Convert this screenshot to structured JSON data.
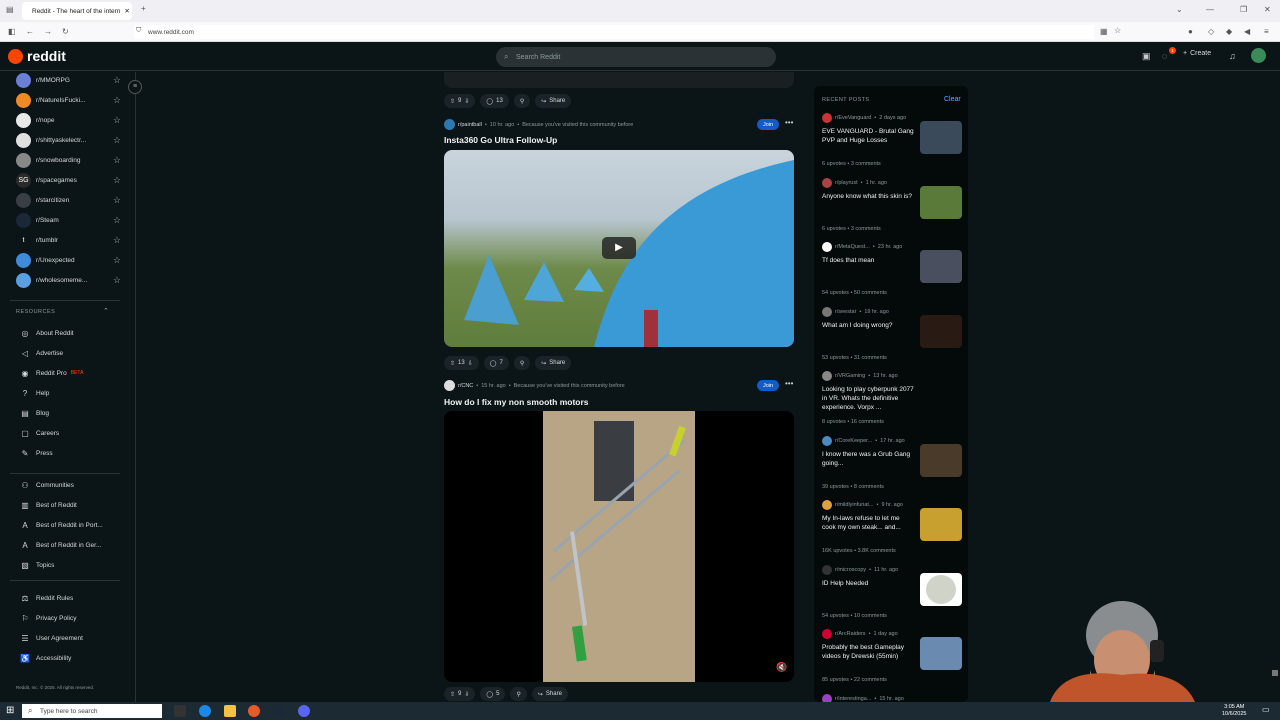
{
  "browser": {
    "tab_title": "Reddit - The heart of the intern",
    "url": "www.reddit.com"
  },
  "header": {
    "logo_text": "reddit",
    "search_placeholder": "Search Reddit",
    "create_label": "Create",
    "notif_badge": "1"
  },
  "sidebar": {
    "subs": [
      {
        "name": "r/MMORPG",
        "color": "#6b7fd7"
      },
      {
        "name": "r/NatureIsFucki...",
        "color": "#f08a24"
      },
      {
        "name": "r/nope",
        "color": "#e8e8e8"
      },
      {
        "name": "r/shittyaskelectr...",
        "color": "#e0e0e0"
      },
      {
        "name": "r/snowboarding",
        "color": "#888888"
      },
      {
        "name": "r/spacegames",
        "color": "#2a2a2a",
        "text": "SG"
      },
      {
        "name": "r/starcitizen",
        "color": "#3a3f45"
      },
      {
        "name": "r/Steam",
        "color": "#1b2838"
      },
      {
        "name": "r/tumblr",
        "color": "#0b1416",
        "text": "t"
      },
      {
        "name": "r/Unexpected",
        "color": "#3d8bd9"
      },
      {
        "name": "r/wholesomeme...",
        "color": "#5aa0e0"
      }
    ],
    "resources_heading": "RESOURCES",
    "resources": [
      {
        "label": "About Reddit",
        "icon": "reddit-icon"
      },
      {
        "label": "Advertise",
        "icon": "megaphone-icon"
      },
      {
        "label": "Reddit Pro",
        "icon": "pro-icon",
        "badge": "BETA"
      },
      {
        "label": "Help",
        "icon": "help-icon"
      },
      {
        "label": "Blog",
        "icon": "blog-icon"
      },
      {
        "label": "Careers",
        "icon": "briefcase-icon"
      },
      {
        "label": "Press",
        "icon": "press-icon"
      }
    ],
    "explore": [
      {
        "label": "Communities",
        "icon": "communities-icon"
      },
      {
        "label": "Best of Reddit",
        "icon": "book-icon"
      },
      {
        "label": "Best of Reddit in Port...",
        "icon": "translate-icon"
      },
      {
        "label": "Best of Reddit in Ger...",
        "icon": "translate-icon"
      },
      {
        "label": "Topics",
        "icon": "topics-icon"
      }
    ],
    "policies": [
      {
        "label": "Reddit Rules",
        "icon": "rules-icon"
      },
      {
        "label": "Privacy Policy",
        "icon": "privacy-icon"
      },
      {
        "label": "User Agreement",
        "icon": "agreement-icon"
      },
      {
        "label": "Accessibility",
        "icon": "accessibility-icon"
      }
    ],
    "copyright": "Reddit, Inc. © 2025. All rights reserved."
  },
  "feed": {
    "top_actions": {
      "votes": "9",
      "comments": "13",
      "share": "Share"
    },
    "post1": {
      "subreddit": "r/paintball",
      "time": "10 hr. ago",
      "reason": "Because you've visited this community before",
      "title": "Insta360 Go Ultra Follow-Up",
      "join": "Join",
      "votes": "13",
      "comments": "7",
      "share": "Share"
    },
    "post2": {
      "subreddit": "r/CNC",
      "time": "15 hr. ago",
      "reason": "Because you've visited this community before",
      "title": "How do I fix my non smooth motors",
      "join": "Join",
      "votes": "9",
      "comments": "5",
      "share": "Share"
    }
  },
  "recent": {
    "heading": "RECENT POSTS",
    "clear": "Clear",
    "items": [
      {
        "sub": "r/EveVanguard",
        "time": "2 days ago",
        "title": "EVE VANGUARD - Brutal Gang PVP and Huge Losses",
        "upvotes": "6 upvotes",
        "comments": "3 comments",
        "thumb": "#3a4a5a",
        "avatar": "#c33"
      },
      {
        "sub": "r/playrust",
        "time": "1 hr. ago",
        "title": "Anyone know what this skin is?",
        "upvotes": "6 upvotes",
        "comments": "3 comments",
        "thumb": "#5a7a3a",
        "avatar": "#a44"
      },
      {
        "sub": "r/MetaQuest...",
        "time": "23 hr. ago",
        "title": "Tf does that mean",
        "upvotes": "54 upvotes",
        "comments": "50 comments",
        "thumb": "#4a4f60",
        "avatar": "#ffffff"
      },
      {
        "sub": "r/seestar",
        "time": "19 hr. ago",
        "title": "What am I doing wrong?",
        "upvotes": "53 upvotes",
        "comments": "31 comments",
        "thumb": "#2a1a14",
        "avatar": "#777"
      },
      {
        "sub": "r/VRGaming",
        "time": "13 hr. ago",
        "title": "Looking to play cyberpunk 2077 in VR. Whats the definitive experience. Vorpx ...",
        "upvotes": "8 upvotes",
        "comments": "16 comments",
        "thumb": "",
        "avatar": "#888"
      },
      {
        "sub": "r/CoreKeeper...",
        "time": "17 hr. ago",
        "title": "I know there was a Grub Gang going...",
        "upvotes": "39 upvotes",
        "comments": "8 comments",
        "thumb": "#4a3a2a",
        "avatar": "#4a8ac0"
      },
      {
        "sub": "r/mildlyinfuriat...",
        "time": "9 hr. ago",
        "title": "My In-laws refuse to let me cook my own steak... and...",
        "upvotes": "16K upvotes",
        "comments": "3.8K comments",
        "thumb": "#c8a030",
        "avatar": "#e0a040"
      },
      {
        "sub": "r/microscopy",
        "time": "11 hr. ago",
        "title": "ID Help Needed",
        "upvotes": "54 upvotes",
        "comments": "10 comments",
        "thumb": "#d0d4c8",
        "avatar": "#333"
      },
      {
        "sub": "r/ArcRaiders",
        "time": "1 day ago",
        "title": "Probably the best Gameplay videos by Drewski (55min)",
        "upvotes": "85 upvotes",
        "comments": "22 comments",
        "thumb": "#6a8ab0",
        "avatar": "#c03"
      },
      {
        "sub": "r/interestinga...",
        "time": "15 hr. ago",
        "title": "",
        "upvotes": "",
        "comments": "",
        "thumb": "#a02060",
        "avatar": "#a040c0"
      }
    ]
  },
  "taskbar": {
    "search_placeholder": "Type here to search",
    "time": "3:05 AM",
    "date": "10/6/2025"
  }
}
